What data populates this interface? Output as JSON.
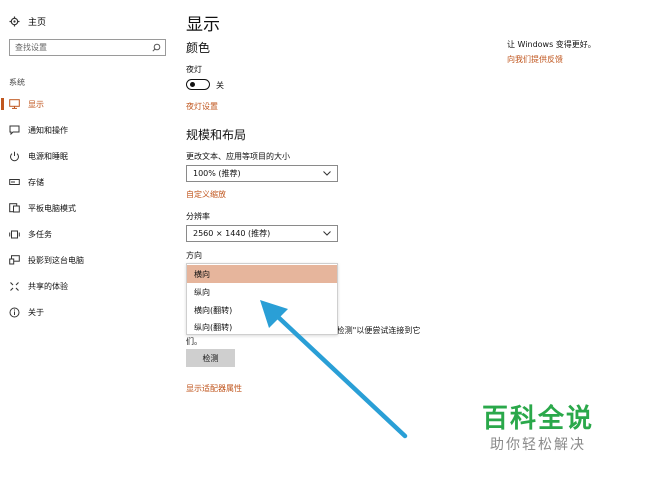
{
  "sidebar": {
    "home_label": "主页",
    "search_placeholder": "查找设置",
    "section_label": "系统",
    "items": [
      {
        "label": "显示",
        "icon": "monitor-icon",
        "active": true
      },
      {
        "label": "通知和操作",
        "icon": "message-icon",
        "active": false
      },
      {
        "label": "电源和睡眠",
        "icon": "power-icon",
        "active": false
      },
      {
        "label": "存储",
        "icon": "storage-icon",
        "active": false
      },
      {
        "label": "平板电脑模式",
        "icon": "tablet-icon",
        "active": false
      },
      {
        "label": "多任务",
        "icon": "multitask-icon",
        "active": false
      },
      {
        "label": "投影到这台电脑",
        "icon": "project-icon",
        "active": false
      },
      {
        "label": "共享的体验",
        "icon": "share-icon",
        "active": false
      },
      {
        "label": "关于",
        "icon": "info-icon",
        "active": false
      }
    ]
  },
  "main": {
    "title": "显示",
    "color_heading": "颜色",
    "night_light_label": "夜灯",
    "night_light_state": "关",
    "night_light_on": false,
    "night_light_settings_link": "夜灯设置",
    "scale_heading": "规模和布局",
    "scale_label": "更改文本、应用等项目的大小",
    "scale_value": "100% (推荐)",
    "custom_scale_link": "自定义缩放",
    "resolution_label": "分辨率",
    "resolution_value": "2560 × 1440 (推荐)",
    "orientation_label": "方向",
    "orientation_options": [
      "横向",
      "纵向",
      "横向(翻转)",
      "纵向(翻转)"
    ],
    "orientation_selected_index": 0,
    "detect_text_tail": "\"检测\"以便尝试连接到它",
    "detect_text_line2": "们。",
    "detect_button": "检测",
    "adapter_link": "显示适配器属性"
  },
  "right": {
    "text": "让 Windows 变得更好。",
    "link": "向我们提供反馈"
  },
  "watermark": {
    "main": "百科全说",
    "sub": "助你轻松解决"
  },
  "colors": {
    "accent": "#c0561e",
    "selected_bg": "#e6b59c",
    "arrow": "#2a9fd6",
    "watermark_green": "#2aa84a"
  }
}
